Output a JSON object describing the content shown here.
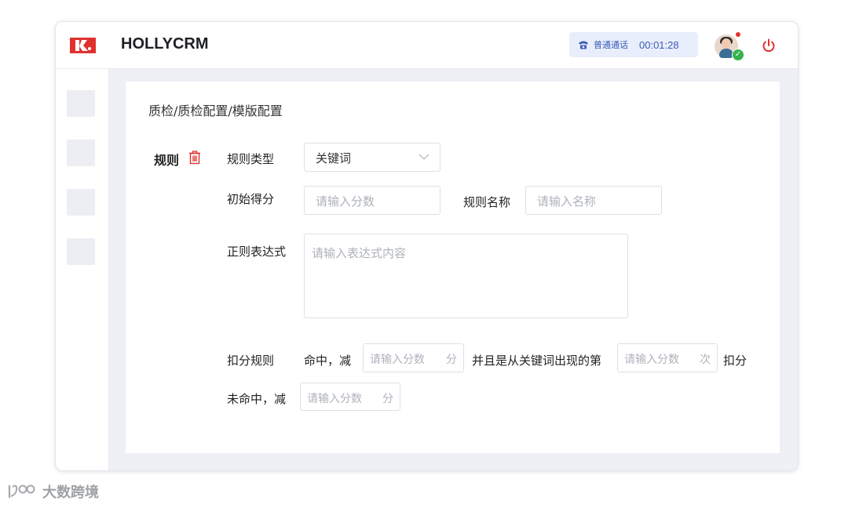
{
  "header": {
    "logo_text": "K",
    "app_title": "HOLLYCRM",
    "call": {
      "label": "普通通话",
      "timer": "00:01:28"
    },
    "icons": {
      "phone": "phone-icon",
      "power": "power-icon",
      "avatar_status": "online-check-icon"
    }
  },
  "sidebar": {
    "items": [
      "",
      "",
      "",
      ""
    ]
  },
  "content": {
    "breadcrumb": "质检/质检配置/模版配置",
    "rule_label": "规则",
    "rule_type": {
      "label": "规则类型",
      "value": "关键词"
    },
    "initial_score": {
      "label": "初始得分",
      "placeholder": "请输入分数"
    },
    "rule_name": {
      "label": "规则名称",
      "placeholder": "请输入名称"
    },
    "regex": {
      "label": "正则表达式",
      "placeholder": "请输入表达式内容"
    },
    "deduction": {
      "label": "扣分规则",
      "hit_prefix": "命中，减",
      "hit_placeholder": "请输入分数",
      "hit_unit": "分",
      "and_text": "并且是从关键词出现的第",
      "times_placeholder": "请输入分数",
      "times_unit": "次",
      "deduct_text": "扣分",
      "miss_prefix": "未命中，减",
      "miss_placeholder": "请输入分数",
      "miss_unit": "分"
    }
  },
  "watermark": "大数跨境",
  "colors": {
    "brand_red": "#e0312e",
    "accent_blue": "#3a5bb8",
    "online_green": "#36b34a"
  }
}
